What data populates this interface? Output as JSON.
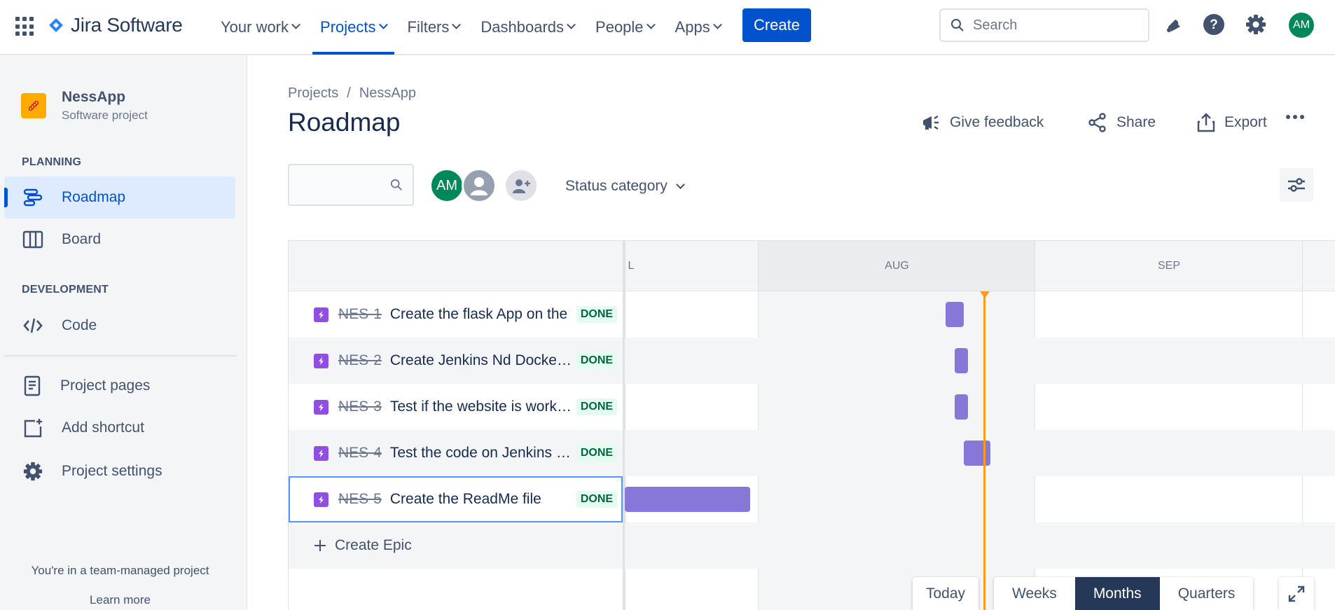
{
  "topnav": {
    "logo_text": "Jira Software",
    "items": [
      {
        "label": "Your work"
      },
      {
        "label": "Projects"
      },
      {
        "label": "Filters"
      },
      {
        "label": "Dashboards"
      },
      {
        "label": "People"
      },
      {
        "label": "Apps"
      }
    ],
    "active_item": "Projects",
    "create_label": "Create",
    "search_placeholder": "Search",
    "avatar_initials": "AM"
  },
  "sidebar": {
    "project_name": "NessApp",
    "project_type": "Software project",
    "planning_title": "PLANNING",
    "planning_items": [
      {
        "label": "Roadmap",
        "icon": "roadmap-icon",
        "active": true
      },
      {
        "label": "Board",
        "icon": "board-icon",
        "active": false
      }
    ],
    "development_title": "DEVELOPMENT",
    "development_items": [
      {
        "label": "Code",
        "icon": "code-icon"
      }
    ],
    "other_items": [
      {
        "label": "Project pages",
        "icon": "pages-icon"
      },
      {
        "label": "Add shortcut",
        "icon": "add-shortcut-icon"
      },
      {
        "label": "Project settings",
        "icon": "gear-icon"
      }
    ],
    "footer_text": "You're in a team-managed project",
    "footer_link": "Learn more"
  },
  "main": {
    "breadcrumb": [
      "Projects",
      "NessApp"
    ],
    "breadcrumb_sep": "/",
    "title": "Roadmap",
    "actions": {
      "feedback": "Give feedback",
      "share": "Share",
      "export": "Export"
    },
    "avatars": [
      {
        "initials": "AM",
        "color": "#00875a"
      }
    ],
    "status_filter": "Status category"
  },
  "timeline": {
    "months": [
      "L",
      "AUG",
      "SEP"
    ],
    "issues": [
      {
        "key": "NES-1",
        "summary": "Create the flask App on the",
        "status": "DONE"
      },
      {
        "key": "NES-2",
        "summary": "Create Jenkins Nd Docker file",
        "status": "DONE"
      },
      {
        "key": "NES-3",
        "summary": "Test if the website is working",
        "status": "DONE"
      },
      {
        "key": "NES-4",
        "summary": "Test the code on Jenkins (CI)",
        "status": "DONE"
      },
      {
        "key": "NES-5",
        "summary": "Create the ReadMe file",
        "status": "DONE"
      }
    ],
    "create_epic_label": "Create Epic",
    "today_label": "Today",
    "zoom_options": [
      "Weeks",
      "Months",
      "Quarters"
    ],
    "zoom_selected": "Months"
  },
  "colors": {
    "brand": "#0052cc",
    "epic_bar": "#8777d9",
    "today_line": "#ff991f",
    "done_lozenge_bg": "#e3fcef",
    "done_lozenge_text": "#006644"
  }
}
